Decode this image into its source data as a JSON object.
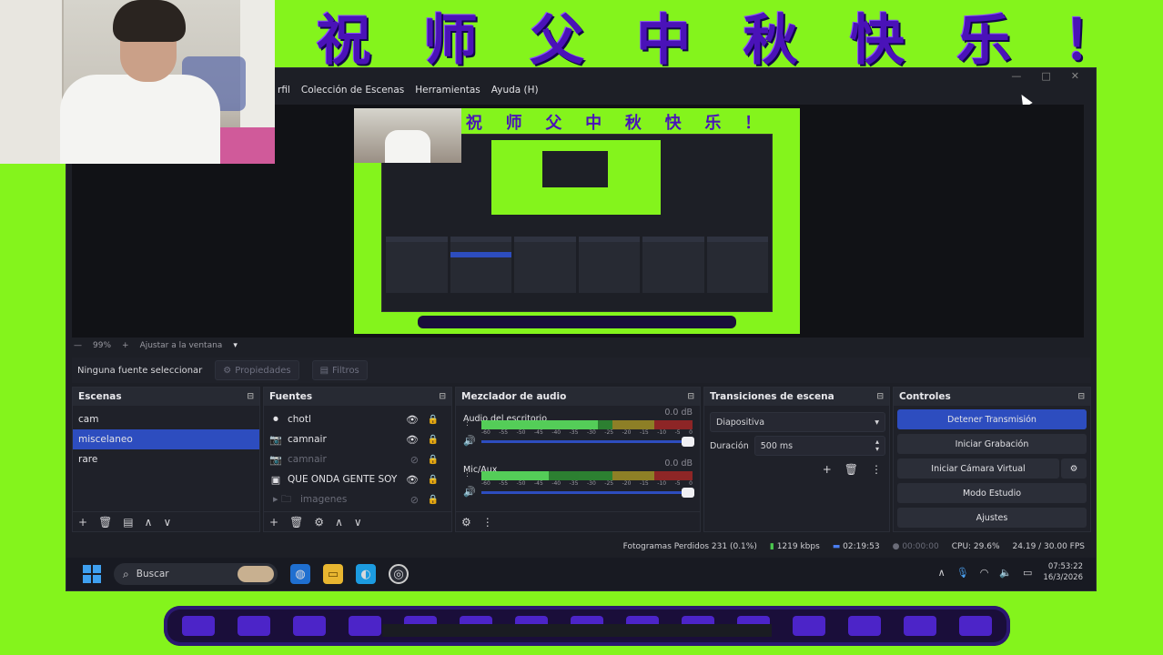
{
  "banner_top": [
    "祝",
    "师",
    "父",
    "中",
    "秋",
    "快",
    "乐",
    "！"
  ],
  "menu": [
    "rfil",
    "Colección de Escenas",
    "Herramientas",
    "Ayuda (H)"
  ],
  "window_controls": [
    "—",
    "□",
    "✕"
  ],
  "preview": {
    "zoom_minus": "—",
    "zoom_value": "99%",
    "zoom_plus": "+",
    "fit_label": "Ajustar a la ventana",
    "fit_caret": "▾"
  },
  "props_bar": {
    "no_source": "Ninguna fuente seleccionar",
    "properties": "Propiedades",
    "filters": "Filtros"
  },
  "scenes": {
    "title": "Escenas",
    "items": [
      "cam",
      "miscelaneo",
      "rare"
    ],
    "active_index": 1,
    "footer": [
      "+",
      "🗑",
      "▤",
      "∧",
      "∨"
    ]
  },
  "sources": {
    "title": "Fuentes",
    "items": [
      {
        "icon": "⏺",
        "name": "chotl",
        "dim": false
      },
      {
        "icon": "📷",
        "name": "camnair",
        "dim": false
      },
      {
        "icon": "📷",
        "name": "camnair",
        "dim": true
      },
      {
        "icon": "▣",
        "name": "QUE ONDA GENTE SOY E",
        "dim": false
      },
      {
        "icon": "▸ 🗀",
        "name": "imagenes",
        "dim": true
      }
    ],
    "footer": [
      "+",
      "🗑",
      "⚙",
      "∧",
      "∨"
    ]
  },
  "mixer": {
    "title": "Mezclador de audio",
    "channels": [
      {
        "name": "Audio del escritorio",
        "db": "0.0 dB",
        "level": 0.55
      },
      {
        "name": "Mic/Aux",
        "db": "0.0 dB",
        "level": 0.32
      }
    ],
    "ticks": [
      "-60",
      "-55",
      "-50",
      "-45",
      "-40",
      "-35",
      "-30",
      "-25",
      "-20",
      "-15",
      "-10",
      "-5",
      "0"
    ],
    "footer": [
      "⚙",
      "⋮"
    ]
  },
  "transitions": {
    "title": "Transiciones de escena",
    "type": "Diapositiva",
    "duration_label": "Duración",
    "duration_value": "500 ms",
    "footer": [
      "+",
      "🗑",
      "⋮"
    ]
  },
  "controls": {
    "title": "Controles",
    "stop_stream": "Detener Transmisión",
    "start_rec": "Iniciar Grabación",
    "virtual_cam": "Iniciar Cámara Virtual",
    "studio": "Modo Estudio",
    "settings": "Ajustes"
  },
  "status": {
    "dropped": "Fotogramas Perdidos 231 (0.1%)",
    "bitrate": "1219 kbps",
    "stream_time": "02:19:53",
    "rec_time": "00:00:00",
    "cpu": "CPU: 29.6%",
    "fps": "24.19 / 30.00 FPS"
  },
  "taskbar": {
    "search": "Buscar",
    "time": "07:53:22",
    "date": "16/3/2026"
  }
}
